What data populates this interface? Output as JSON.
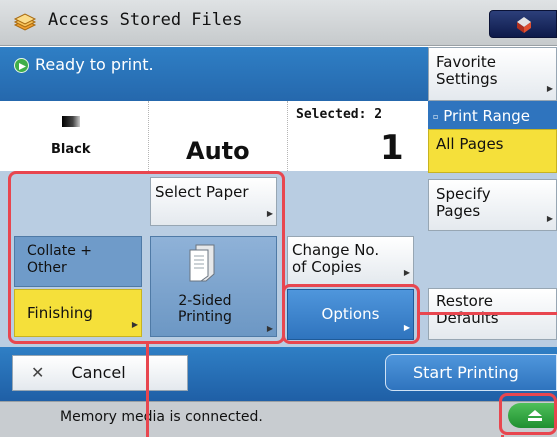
{
  "title_bar": {
    "title": "Access Stored Files",
    "icon": "folder-stack-icon",
    "home_icon": "home-icon"
  },
  "status": {
    "text": "Ready to print.",
    "icon": "ready-status-icon"
  },
  "info": {
    "color_label": "Black",
    "paper_value": "Auto",
    "selected_label": "Selected:  2",
    "copies_value": "1"
  },
  "buttons": {
    "select_paper": "Select Paper",
    "collate_line1": "Collate +",
    "collate_line2": "Other",
    "finishing": "Finishing",
    "two_sided_line1": "2-Sided",
    "two_sided_line2": "Printing",
    "change_copies_line1": "Change No.",
    "change_copies_line2": "of Copies",
    "options": "Options"
  },
  "right_panel": {
    "favorite_line1": "Favorite",
    "favorite_line2": "Settings",
    "print_range_header": "Print Range",
    "all_pages": "All Pages",
    "specify_line1": "Specify",
    "specify_line2": "Pages",
    "restore_line1": "Restore",
    "restore_line2": "Defaults"
  },
  "actions": {
    "cancel": "Cancel",
    "start": "Start Printing"
  },
  "footer": {
    "text": "Memory media is connected.",
    "eject_icon": "eject-icon"
  },
  "colors": {
    "accent_blue": "#2f74be",
    "selected_yellow": "#f5e03a",
    "highlight_red": "#e8464f",
    "ready_green": "#3fae49"
  }
}
